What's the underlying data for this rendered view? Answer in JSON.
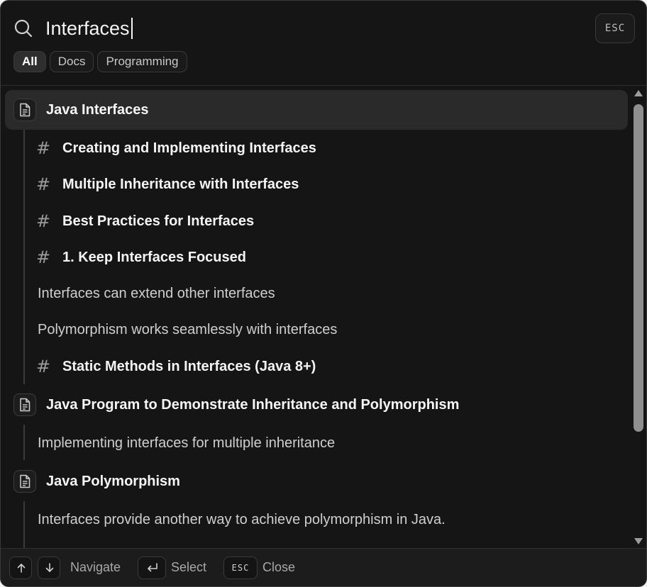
{
  "search": {
    "value": "Interfaces",
    "esc_label": "ESC"
  },
  "filters": [
    {
      "label": "All",
      "active": true
    },
    {
      "label": "Docs",
      "active": false
    },
    {
      "label": "Programming",
      "active": false
    }
  ],
  "results": [
    {
      "title": "Java Interfaces",
      "selected": true,
      "children": [
        {
          "type": "heading",
          "text": "Creating and Implementing Interfaces"
        },
        {
          "type": "heading",
          "text": "Multiple Inheritance with Interfaces"
        },
        {
          "type": "heading",
          "text": "Best Practices for Interfaces"
        },
        {
          "type": "heading",
          "text": "1. Keep Interfaces Focused"
        },
        {
          "type": "text",
          "text": "Interfaces can extend other interfaces"
        },
        {
          "type": "text",
          "text": "Polymorphism works seamlessly with interfaces"
        },
        {
          "type": "heading",
          "text": "Static Methods in Interfaces (Java 8+)"
        }
      ]
    },
    {
      "title": "Java Program to Demonstrate Inheritance and Polymorphism",
      "selected": false,
      "children": [
        {
          "type": "text",
          "text": "Implementing interfaces for multiple inheritance"
        }
      ]
    },
    {
      "title": "Java Polymorphism",
      "selected": false,
      "children": [
        {
          "type": "text",
          "text": "Interfaces provide another way to achieve polymorphism in Java."
        }
      ]
    }
  ],
  "footer": {
    "navigate_label": "Navigate",
    "select_label": "Select",
    "close_key": "ESC",
    "close_label": "Close"
  }
}
